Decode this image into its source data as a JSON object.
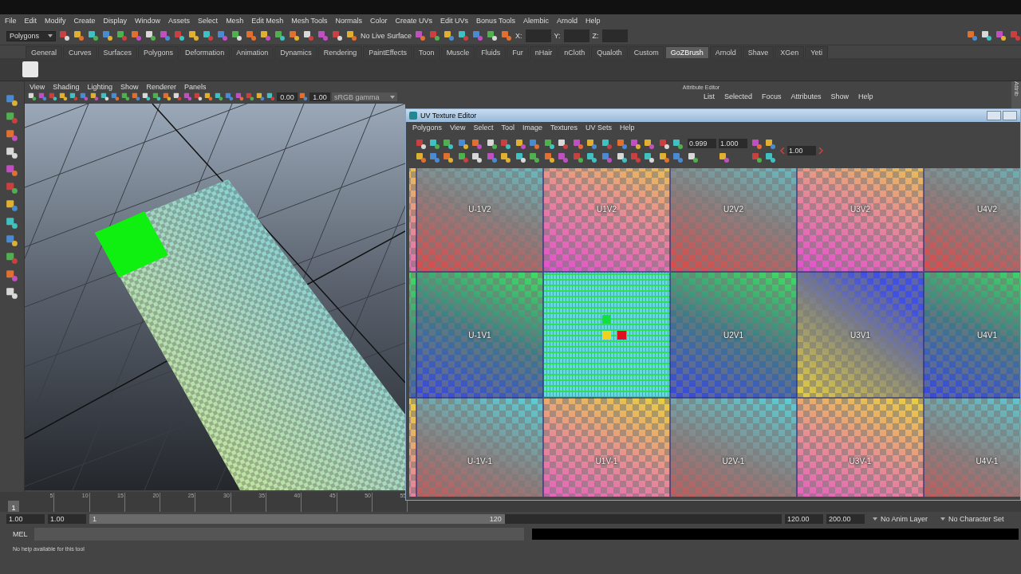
{
  "menu_bar": [
    "File",
    "Edit",
    "Modify",
    "Create",
    "Display",
    "Window",
    "Assets",
    "Select",
    "Mesh",
    "Edit Mesh",
    "Mesh Tools",
    "Normals",
    "Color",
    "Create UVs",
    "Edit UVs",
    "Bonus Tools",
    "Alembic",
    "Arnold",
    "Help"
  ],
  "status_line": {
    "mode": "Polygons",
    "live_surface": "No Live Surface",
    "coord_labels": [
      "X:",
      "Y:",
      "Z:"
    ]
  },
  "shelf": {
    "tabs": [
      {
        "label": "General",
        "selected": false
      },
      {
        "label": "Curves",
        "selected": false
      },
      {
        "label": "Surfaces",
        "selected": false
      },
      {
        "label": "Polygons",
        "selected": false
      },
      {
        "label": "Deformation",
        "selected": false
      },
      {
        "label": "Animation",
        "selected": false
      },
      {
        "label": "Dynamics",
        "selected": false
      },
      {
        "label": "Rendering",
        "selected": false
      },
      {
        "label": "PaintEffects",
        "selected": false
      },
      {
        "label": "Toon",
        "selected": false
      },
      {
        "label": "Muscle",
        "selected": false
      },
      {
        "label": "Fluids",
        "selected": false
      },
      {
        "label": "Fur",
        "selected": false
      },
      {
        "label": "nHair",
        "selected": false
      },
      {
        "label": "nCloth",
        "selected": false
      },
      {
        "label": "Qualoth",
        "selected": false
      },
      {
        "label": "Custom",
        "selected": false
      },
      {
        "label": "GoZBrush",
        "selected": true
      },
      {
        "label": "Arnold",
        "selected": false
      },
      {
        "label": "Shave",
        "selected": false
      },
      {
        "label": "XGen",
        "selected": false
      },
      {
        "label": "Yeti",
        "selected": false
      }
    ]
  },
  "viewport": {
    "menus": [
      "View",
      "Shading",
      "Lighting",
      "Show",
      "Renderer",
      "Panels"
    ],
    "exposure": "0.00",
    "gamma": "1.00",
    "color_space": "sRGB gamma"
  },
  "attribute_editor": {
    "title": "Attribute Editor",
    "menus": [
      "List",
      "Selected",
      "Focus",
      "Attributes",
      "Show",
      "Help"
    ],
    "side_tab": "Attrib"
  },
  "uv_editor": {
    "title": "UV Texture Editor",
    "menus": [
      "Polygons",
      "View",
      "Select",
      "Tool",
      "Image",
      "Textures",
      "UV Sets",
      "Help"
    ],
    "fields": [
      "0.999",
      "1.000"
    ],
    "zoom": "1.00",
    "tiles": [
      [
        {
          "kind": "tile",
          "label": "U-1V2"
        },
        {
          "kind": "tile",
          "label": "U1V2"
        },
        {
          "kind": "tile",
          "label": "U2V2"
        },
        {
          "kind": "tile",
          "label": "U3V2"
        },
        {
          "kind": "tile",
          "label": "U4V2"
        }
      ],
      [
        {
          "kind": "tile",
          "label": "U-1V1"
        },
        {
          "kind": "uv_shell"
        },
        {
          "kind": "tile",
          "label": "U2V1"
        },
        {
          "kind": "tile",
          "label": "U3V1"
        },
        {
          "kind": "tile",
          "label": "U4V1"
        }
      ],
      [
        {
          "kind": "tile",
          "label": "U-1V-1"
        },
        {
          "kind": "tile",
          "label": "U1V-1"
        },
        {
          "kind": "tile",
          "label": "U2V-1"
        },
        {
          "kind": "tile",
          "label": "U3V-1"
        },
        {
          "kind": "tile",
          "label": "U4V-1"
        }
      ]
    ]
  },
  "timeline": {
    "current_frame": "1",
    "ticks": [
      "5",
      "10",
      "15",
      "20",
      "25",
      "30",
      "35",
      "40",
      "45",
      "50",
      "55"
    ]
  },
  "range": {
    "start": "1.00",
    "anim_start": "1.00",
    "slider_start": "1",
    "slider_end": "120",
    "level": 0.6,
    "anim_end": "120.00",
    "end": "200.00",
    "anim_layer": "No Anim Layer",
    "character_set": "No Character Set"
  },
  "command_line": {
    "label": "MEL"
  },
  "help_line": "No help available for this tool"
}
